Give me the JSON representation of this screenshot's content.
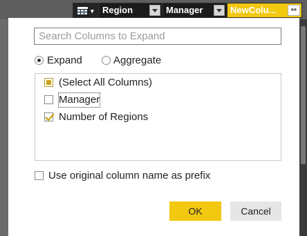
{
  "header": {
    "columns": [
      {
        "label": "Region"
      },
      {
        "label": "Manager"
      },
      {
        "label": "NewColu..."
      }
    ],
    "expand_icon_glyph": "⇿"
  },
  "dialog": {
    "search_placeholder": "Search Columns to Expand",
    "mode": {
      "expand_label": "Expand",
      "aggregate_label": "Aggregate",
      "selected": "Expand"
    },
    "columns_list": [
      {
        "label": "(Select All Columns)",
        "state": "partial"
      },
      {
        "label": "Manager",
        "state": "unchecked"
      },
      {
        "label": "Number of Regions",
        "state": "checked"
      }
    ],
    "prefix_label": "Use original column name as prefix",
    "ok_label": "OK",
    "cancel_label": "Cancel"
  },
  "colors": {
    "accent": "#f2c811",
    "header_bg": "#1b1b1b"
  }
}
